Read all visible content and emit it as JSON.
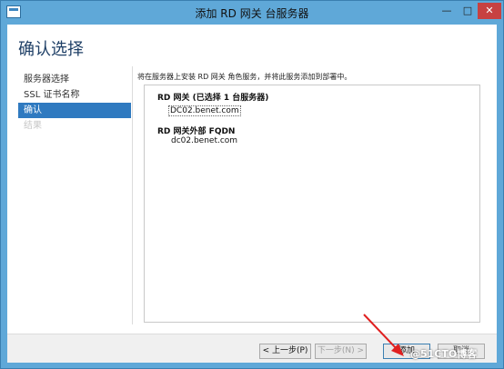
{
  "window": {
    "title": "添加 RD 网关 台服务器",
    "controls": {
      "minimize": "—",
      "maximize": "□",
      "close": "✕"
    }
  },
  "page": {
    "title": "确认选择"
  },
  "nav": {
    "items": [
      {
        "label": "服务器选择",
        "state": "normal"
      },
      {
        "label": "SSL 证书名称",
        "state": "normal"
      },
      {
        "label": "确认",
        "state": "active"
      },
      {
        "label": "结果",
        "state": "disabled"
      }
    ]
  },
  "content": {
    "intro": "将在服务器上安装 RD 网关 角色服务，并将此服务添加到部署中。",
    "groups": [
      {
        "heading": "RD 网关 (已选择 1 台服务器)",
        "value": "DC02.benet.com"
      },
      {
        "heading": "RD 网关外部 FQDN",
        "value": "dc02.benet.com"
      }
    ]
  },
  "footer": {
    "prev": "< 上一步(P)",
    "next": "下一步(N) >",
    "add": "添加",
    "cancel": "取消"
  },
  "watermark": "@51CTO博客",
  "colors": {
    "accent": "#2f7ac0",
    "frame": "#5fa8d8",
    "close": "#c74141",
    "annotation_arrow": "#e02020"
  }
}
